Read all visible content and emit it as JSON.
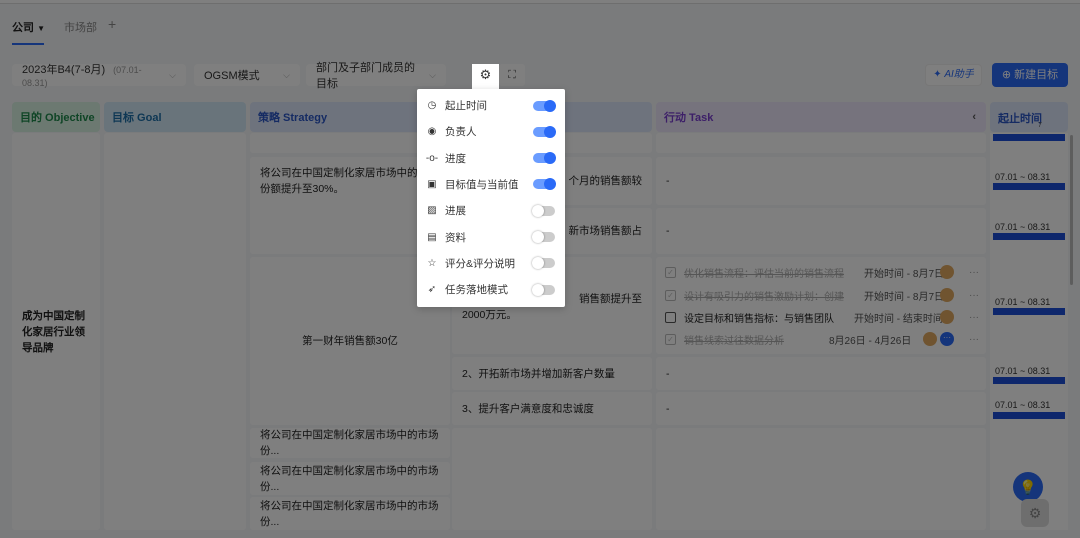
{
  "tabs": [
    {
      "label": "公司"
    },
    {
      "label": "市场部"
    }
  ],
  "toolbar": {
    "period": "2023年B4(7-8月)",
    "period_range": "(07.01-08.31)",
    "mode": "OGSM模式",
    "scope": "部门及子部门成员的目标",
    "ai_label": "AI助手",
    "new_label": "新建目标"
  },
  "headers": {
    "objective": "目的 Objective",
    "goal": "目标 Goal",
    "strategy": "策略 Strategy",
    "task": "行动 Task",
    "time": "起止时间",
    "time_sub": "7"
  },
  "colors": {
    "accent": "#1d4fd8",
    "objective_bg": "#d9f2e3",
    "goal_bg": "#d3e9f7",
    "strategy_bg": "#dde6fa",
    "task_bg": "#ece6fb"
  },
  "objective": "成为中国定制化家居行业领导品牌",
  "strategies": [
    "将公司在中国定制化家居市场中的市场份额提升至30%。",
    "第一财年销售额30亿",
    "将公司在中国定制化家居市场中的市场份...",
    "将公司在中国定制化家居市场中的市场份...",
    "将公司在中国定制化家居市场中的市场份..."
  ],
  "measures": [
    "个月的销售额较",
    "新市场销售额占",
    "销售额提升至",
    "2000万元。",
    "2、开拓新市场并增加新客户数量",
    "3、提升客户满意度和忠诚度"
  ],
  "dash": "-",
  "range": "07.01 ~ 08.31",
  "tasks": [
    {
      "title": "优化销售流程：评估当前的销售流程",
      "date": "开始时间 - 8月7日",
      "done": true
    },
    {
      "title": "设计有吸引力的销售激励计划：创建",
      "date": "开始时间 - 8月7日",
      "done": true
    },
    {
      "title": "设定目标和销售指标：与销售团队",
      "date": "开始时间 - 结束时间",
      "done": false
    },
    {
      "title": "销售线索过往数据分析",
      "date": "8月26日 - 4月26日",
      "done": true
    }
  ],
  "more": "···",
  "settings": [
    {
      "label": "起止时间",
      "icon": "clock-icon",
      "on": true
    },
    {
      "label": "负责人",
      "icon": "user-icon",
      "on": true
    },
    {
      "label": "进度",
      "icon": "progress-icon",
      "on": true
    },
    {
      "label": "目标值与当前值",
      "icon": "target-value-icon",
      "on": true
    },
    {
      "label": "进展",
      "icon": "image-icon",
      "on": false
    },
    {
      "label": "资料",
      "icon": "archive-icon",
      "on": false
    },
    {
      "label": "评分&评分说明",
      "icon": "star-icon",
      "on": false
    },
    {
      "label": "任务落地模式",
      "icon": "run-icon",
      "on": false
    }
  ]
}
